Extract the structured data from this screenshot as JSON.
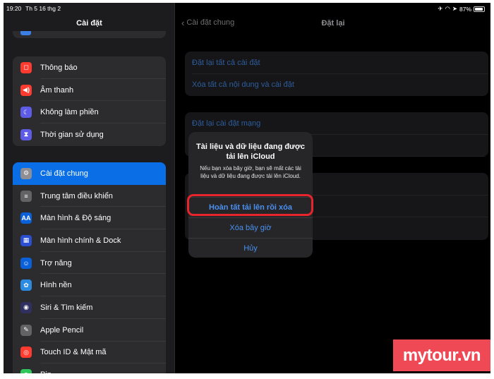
{
  "status_bar": {
    "time": "19:20",
    "date": "Th 5 16 thg 2",
    "battery": "87%"
  },
  "sidebar": {
    "title": "Cài đặt",
    "group1": [
      {
        "label": "Thông báo",
        "icon": "notifications-icon",
        "color": "#ff3b30",
        "glyph": "◻"
      },
      {
        "label": "Âm thanh",
        "icon": "speaker-icon",
        "color": "#ff3b30",
        "glyph": "◀)"
      },
      {
        "label": "Không làm phiền",
        "icon": "moon-icon",
        "color": "#5e5ce6",
        "glyph": "☾"
      },
      {
        "label": "Thời gian sử dụng",
        "icon": "hourglass-icon",
        "color": "#5e5ce6",
        "glyph": "⧗"
      }
    ],
    "group2": [
      {
        "label": "Cài đặt chung",
        "icon": "gear-icon",
        "color": "#8e8e93",
        "glyph": "⚙",
        "selected": true
      },
      {
        "label": "Trung tâm điều khiển",
        "icon": "toggles-icon",
        "color": "#636366",
        "glyph": "≡"
      },
      {
        "label": "Màn hình & Độ sáng",
        "icon": "display-icon",
        "color": "#0a60d8",
        "glyph": "AA"
      },
      {
        "label": "Màn hình chính & Dock",
        "icon": "home-grid-icon",
        "color": "#2a4fd0",
        "glyph": "▦"
      },
      {
        "label": "Trợ năng",
        "icon": "accessibility-icon",
        "color": "#0a60d8",
        "glyph": "☺"
      },
      {
        "label": "Hình nền",
        "icon": "wallpaper-icon",
        "color": "#2a8be0",
        "glyph": "✿"
      },
      {
        "label": "Siri & Tìm kiếm",
        "icon": "siri-icon",
        "color": "#303060",
        "glyph": "◉"
      },
      {
        "label": "Apple Pencil",
        "icon": "pencil-icon",
        "color": "#636366",
        "glyph": "✎"
      },
      {
        "label": "Touch ID & Mật mã",
        "icon": "fingerprint-icon",
        "color": "#ff3b30",
        "glyph": "◎"
      },
      {
        "label": "Pin",
        "icon": "battery-icon",
        "color": "#30c85a",
        "glyph": "▮"
      }
    ]
  },
  "detail": {
    "back_label": "Cài đặt chung",
    "title": "Đặt lại",
    "group1": [
      "Đặt lại tất cả cài đặt",
      "Xóa tất cả nội dung và cài đặt"
    ],
    "group2": [
      "Đặt lại cài đặt mạng"
    ]
  },
  "alert": {
    "title": "Tài liệu và dữ liệu đang được tải lên iCloud",
    "message": "Nếu bạn xóa bây giờ, bạn sẽ mất các tài liệu và dữ liệu đang được tải lên iCloud.",
    "buttons": {
      "finish": "Hoàn tất tải lên rồi xóa",
      "erase_now": "Xóa bây giờ",
      "cancel": "Hủy"
    }
  },
  "watermark": "mytour.vn"
}
